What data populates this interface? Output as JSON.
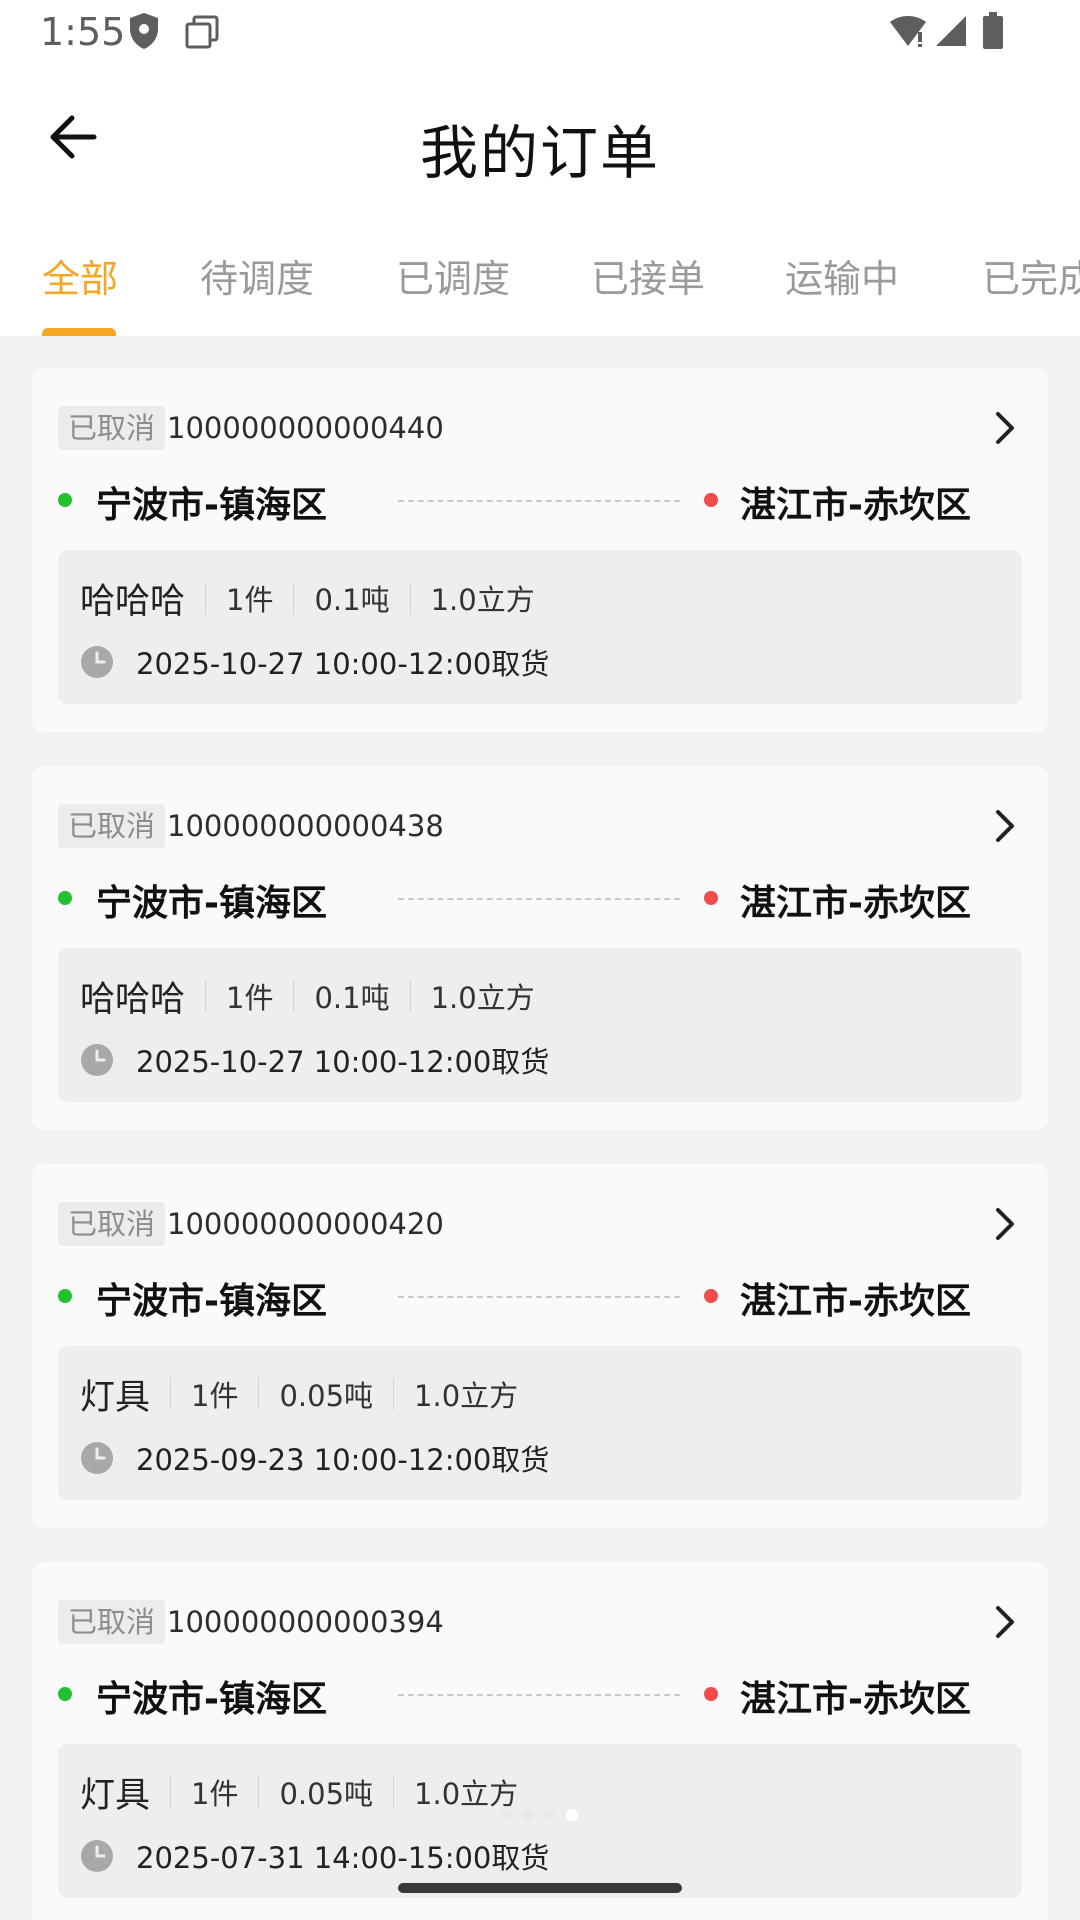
{
  "status_bar": {
    "time": "1:55",
    "icons": [
      "shield-icon",
      "copy-icon",
      "wifi-icon",
      "signal-icon",
      "battery-icon"
    ]
  },
  "header": {
    "title": "我的订单",
    "back_icon": "arrow-left-icon"
  },
  "tabs": [
    {
      "label": "全部",
      "active": true
    },
    {
      "label": "待调度",
      "active": false
    },
    {
      "label": "已调度",
      "active": false
    },
    {
      "label": "已接单",
      "active": false
    },
    {
      "label": "运输中",
      "active": false
    },
    {
      "label": "已完成",
      "active": false
    }
  ],
  "colors": {
    "accent": "#f5a623",
    "origin_dot": "#22c22e",
    "dest_dot": "#f14b4b"
  },
  "orders": [
    {
      "status": "已取消",
      "order_no": "100000000000440",
      "from": "宁波市-镇海区",
      "to": "湛江市-赤坎区",
      "goods": "哈哈哈",
      "pieces": "1件",
      "weight": "0.1吨",
      "volume": "1.0立方",
      "pickup_time": "2025-10-27 10:00-12:00取货"
    },
    {
      "status": "已取消",
      "order_no": "100000000000438",
      "from": "宁波市-镇海区",
      "to": "湛江市-赤坎区",
      "goods": "哈哈哈",
      "pieces": "1件",
      "weight": "0.1吨",
      "volume": "1.0立方",
      "pickup_time": "2025-10-27 10:00-12:00取货"
    },
    {
      "status": "已取消",
      "order_no": "100000000000420",
      "from": "宁波市-镇海区",
      "to": "湛江市-赤坎区",
      "goods": "灯具",
      "pieces": "1件",
      "weight": "0.05吨",
      "volume": "1.0立方",
      "pickup_time": "2025-09-23 10:00-12:00取货"
    },
    {
      "status": "已取消",
      "order_no": "100000000000394",
      "from": "宁波市-镇海区",
      "to": "湛江市-赤坎区",
      "goods": "灯具",
      "pieces": "1件",
      "weight": "0.05吨",
      "volume": "1.0立方",
      "pickup_time": "2025-07-31 14:00-15:00取货"
    }
  ]
}
